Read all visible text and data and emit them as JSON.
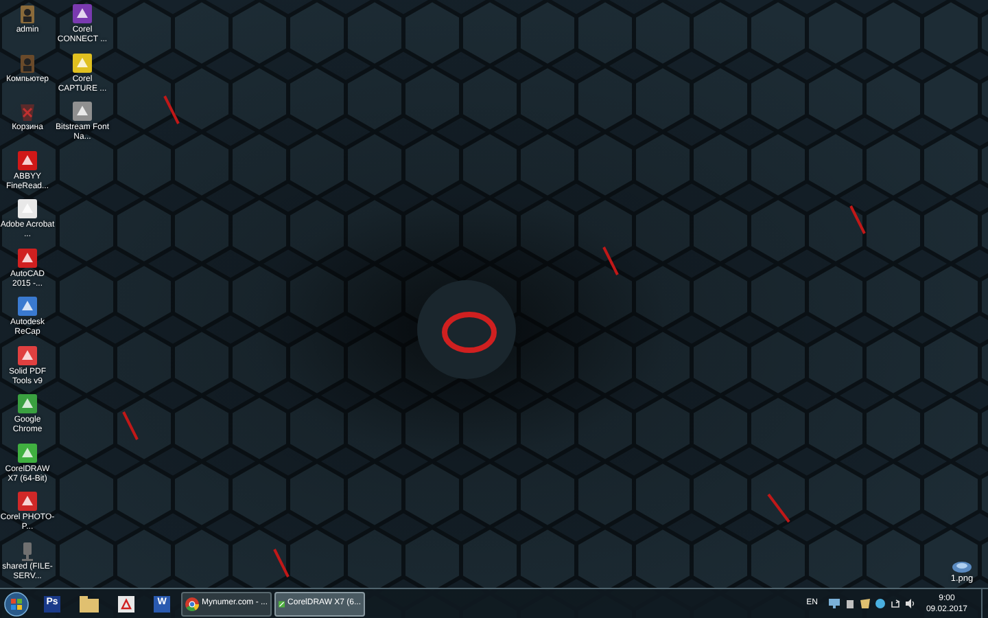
{
  "desktop": {
    "columns": [
      [
        {
          "label": "admin",
          "kind": "user",
          "color": "#8a6a3a"
        },
        {
          "label": "Компьютер",
          "kind": "computer",
          "color": "#6a4a2a"
        },
        {
          "label": "Корзина",
          "kind": "trash",
          "color": "#5a2a2a"
        },
        {
          "label": "ABBYY FineRead...",
          "kind": "app",
          "color": "#d01818"
        },
        {
          "label": "Adobe Acrobat ...",
          "kind": "app",
          "color": "#e8e8e8"
        },
        {
          "label": "AutoCAD 2015 -...",
          "kind": "app",
          "color": "#d02020"
        },
        {
          "label": "Autodesk ReCap",
          "kind": "app",
          "color": "#3a7ad0"
        },
        {
          "label": "Solid PDF Tools v9",
          "kind": "app",
          "color": "#e04040"
        },
        {
          "label": "Google Chrome",
          "kind": "app",
          "color": "#3aa040"
        },
        {
          "label": "CorelDRAW X7 (64-Bit)",
          "kind": "app",
          "color": "#40b040"
        },
        {
          "label": "Corel PHOTO-P...",
          "kind": "app",
          "color": "#d02828"
        },
        {
          "label": "shared (FILE-SERV...",
          "kind": "network",
          "color": "#707070"
        }
      ],
      [
        {
          "label": "Corel CONNECT ...",
          "kind": "app",
          "color": "#7a3ab0"
        },
        {
          "label": "Corel CAPTURE ...",
          "kind": "app",
          "color": "#e0c020"
        },
        {
          "label": "Bitstream Font Na...",
          "kind": "app",
          "color": "#909090"
        }
      ]
    ],
    "corner_icon": {
      "label": "1.png",
      "kind": "image",
      "color": "#5a8ac0"
    }
  },
  "taskbar": {
    "pinned": [
      {
        "glyph": "Ps",
        "kind": "letter",
        "color": "#1a3a8a"
      },
      {
        "kind": "folder",
        "color": "#e0c070"
      },
      {
        "kind": "pdf",
        "color": "#e8e8e8"
      },
      {
        "glyph": "W",
        "kind": "letter",
        "color": "#2a5ab0"
      }
    ],
    "windows": [
      {
        "title": "Mynumer.com - ...",
        "kind": "browser",
        "selected": false
      },
      {
        "title": "CorelDRAW X7 (6...",
        "kind": "draw",
        "selected": true
      }
    ],
    "tray": {
      "language": "EN",
      "time": "9:00",
      "date": "09.02.2017"
    }
  }
}
